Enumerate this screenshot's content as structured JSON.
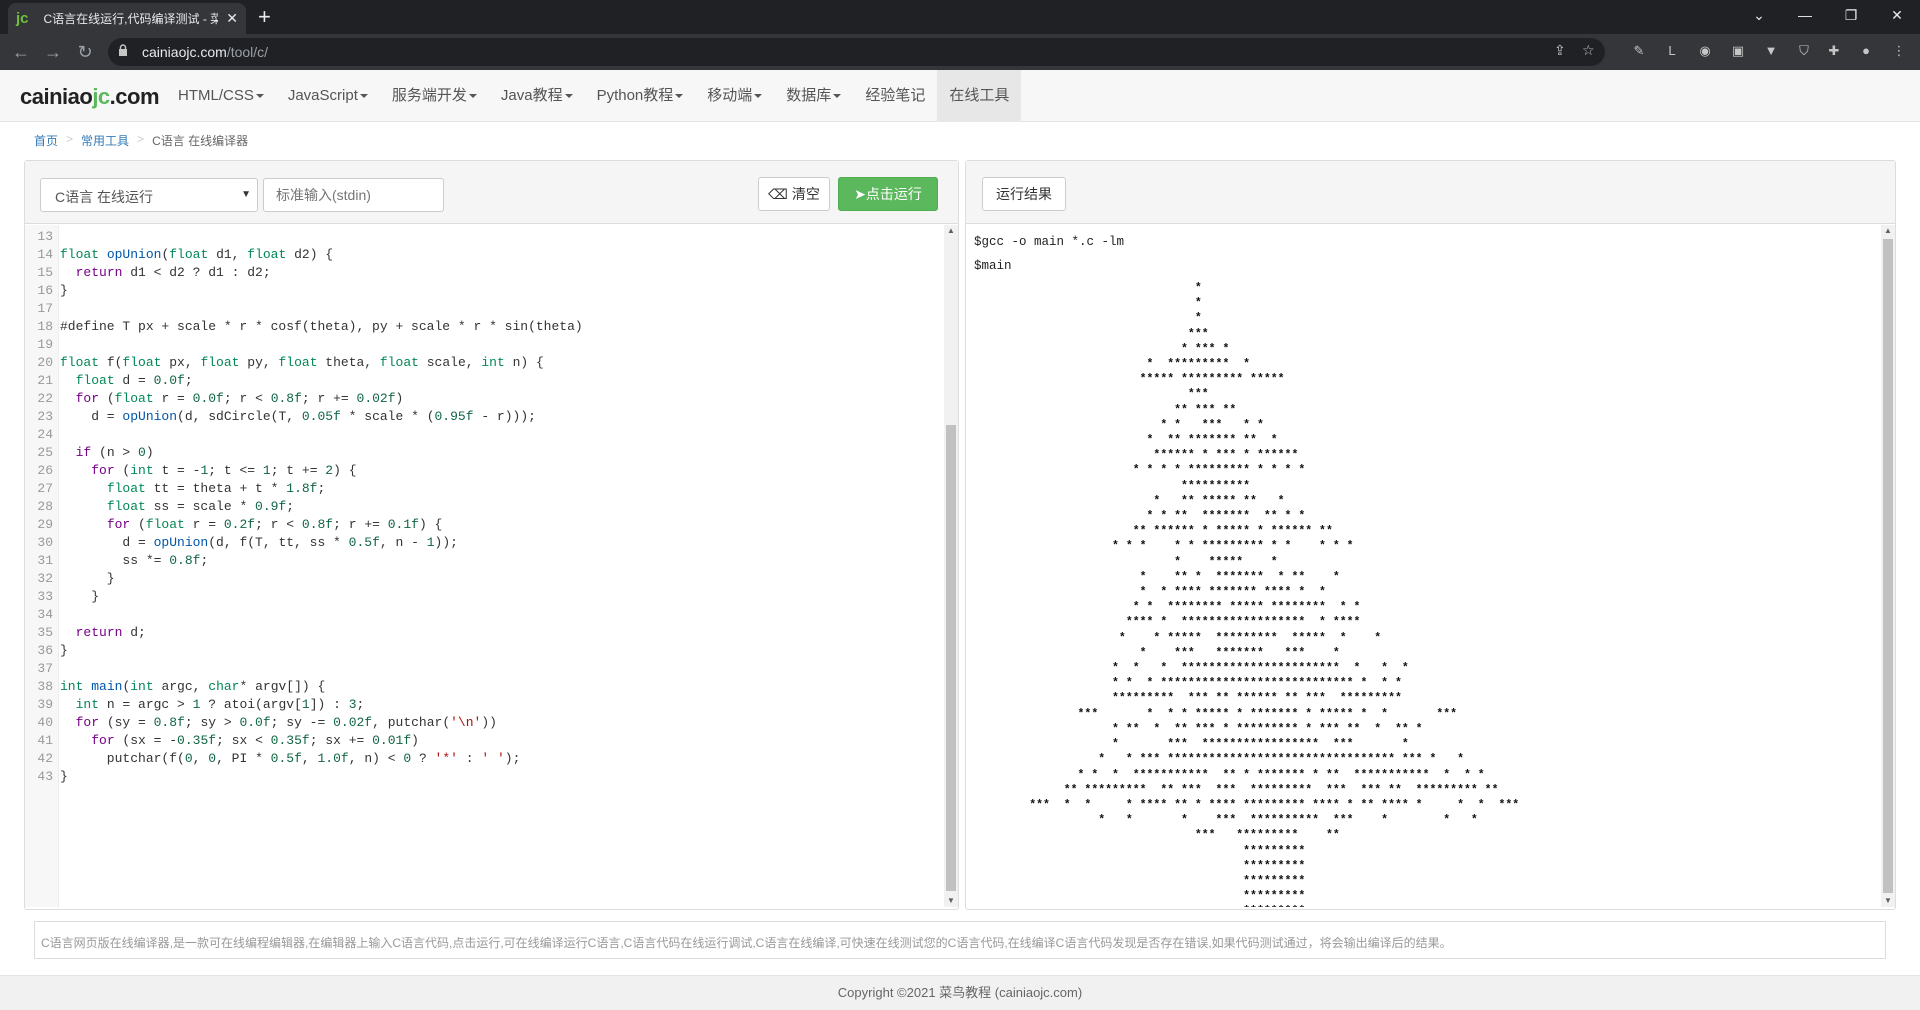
{
  "browser": {
    "tab_title": "C语言在线运行,代码编译测试 - 菜",
    "tab_favicon": "jc",
    "url_host": "cainiaojc.com",
    "url_path": "/tool/c/",
    "icons": [
      "back-icon",
      "forward-icon",
      "reload-icon",
      "lock-icon",
      "share-icon",
      "star-icon",
      "extension-icon",
      "profile-icon",
      "menu-icon"
    ]
  },
  "site": {
    "logo_main": "cainiao",
    "logo_accent": "jc",
    "logo_tail": ".com",
    "nav": [
      {
        "label": "HTML/CSS",
        "caret": true
      },
      {
        "label": "JavaScript",
        "caret": true
      },
      {
        "label": "服务端开发",
        "caret": true
      },
      {
        "label": "Java教程",
        "caret": true
      },
      {
        "label": "Python教程",
        "caret": true
      },
      {
        "label": "移动端",
        "caret": true
      },
      {
        "label": "数据库",
        "caret": true
      },
      {
        "label": "经验笔记",
        "caret": false
      },
      {
        "label": "在线工具",
        "caret": false
      }
    ]
  },
  "breadcrumb": {
    "home": "首页",
    "tools": "常用工具",
    "current": "C语言 在线编译器"
  },
  "editor": {
    "language_select": "C语言 在线运行",
    "stdin_placeholder": "标准输入(stdin)",
    "clear_label": "清空",
    "run_label": "点击运行"
  },
  "code_lines": [
    {
      "n": "13",
      "t": ""
    },
    {
      "n": "14",
      "t": "float opUnion(float d1, float d2) {"
    },
    {
      "n": "15",
      "t": "  return d1 < d2 ? d1 : d2;"
    },
    {
      "n": "16",
      "t": "}"
    },
    {
      "n": "17",
      "t": ""
    },
    {
      "n": "18",
      "t": "#define T px + scale * r * cosf(theta), py + scale * r * sin(theta)"
    },
    {
      "n": "19",
      "t": ""
    },
    {
      "n": "20",
      "t": "float f(float px, float py, float theta, float scale, int n) {"
    },
    {
      "n": "21",
      "t": "  float d = 0.0f;"
    },
    {
      "n": "22",
      "t": "  for (float r = 0.0f; r < 0.8f; r += 0.02f)"
    },
    {
      "n": "23",
      "t": "    d = opUnion(d, sdCircle(T, 0.05f * scale * (0.95f - r)));"
    },
    {
      "n": "24",
      "t": ""
    },
    {
      "n": "25",
      "t": "  if (n > 0)"
    },
    {
      "n": "26",
      "t": "    for (int t = -1; t <= 1; t += 2) {"
    },
    {
      "n": "27",
      "t": "      float tt = theta + t * 1.8f;"
    },
    {
      "n": "28",
      "t": "      float ss = scale * 0.9f;"
    },
    {
      "n": "29",
      "t": "      for (float r = 0.2f; r < 0.8f; r += 0.1f) {"
    },
    {
      "n": "30",
      "t": "        d = opUnion(d, f(T, tt, ss * 0.5f, n - 1));"
    },
    {
      "n": "31",
      "t": "        ss *= 0.8f;"
    },
    {
      "n": "32",
      "t": "      }"
    },
    {
      "n": "33",
      "t": "    }"
    },
    {
      "n": "34",
      "t": ""
    },
    {
      "n": "35",
      "t": "  return d;"
    },
    {
      "n": "36",
      "t": "}"
    },
    {
      "n": "37",
      "t": ""
    },
    {
      "n": "38",
      "t": "int main(int argc, char* argv[]) {"
    },
    {
      "n": "39",
      "t": "  int n = argc > 1 ? atoi(argv[1]) : 3;"
    },
    {
      "n": "40",
      "t": "  for (sy = 0.8f; sy > 0.0f; sy -= 0.02f, putchar('\\n'))"
    },
    {
      "n": "41",
      "t": "    for (sx = -0.35f; sx < 0.35f; sx += 0.01f)"
    },
    {
      "n": "42",
      "t": "      putchar(f(0, 0, PI * 0.5f, 1.0f, n) < 0 ? '*' : ' ');"
    },
    {
      "n": "43",
      "t": "}"
    }
  ],
  "result": {
    "label": "运行结果",
    "cmd1": "$gcc -o main *.c -lm",
    "cmd2": "$main",
    "output": "                                *\n                                *\n                                *\n                               ***\n                              * *** *\n                         *  *********  *\n                        ***** ********* *****\n                               ***\n                             ** *** **\n                           * *   ***   * *\n                         *  ** ******* **  *\n                          ****** * *** * ******\n                       * * * * ********* * * * *\n                              **********\n                          *   ** ***** **   *\n                         * * **  *******  ** * *\n                       ** ****** * ***** * ****** **\n                    * * *    * * ********* * *    * * *\n                             *    *****    *\n                        *    ** *  *******  * **    *\n                        *  * **** ******* **** *  *\n                       * *  ******** ***** ********  * *\n                      **** *  ******************  * ****\n                     *    * *****  *********  *****  *    *\n                        *    ***   *******   ***    *\n                    *  *   *  ***********************  *   *  *\n                    * *  * **************************** *  * *\n                    *********  *** ** ****** ** ***  *********\n               ***       *  * * ***** * ******* * ***** *  *       ***\n                    * **  *  ** *** * ********* * *** **  *  ** *\n                    *       ***  *****************  ***       *\n                  *   * *** ********************************* *** *   *\n               * *  *  ***********  ** * ******* * **  ***********  *  * *\n             ** *********  ** ***  ***  *********  ***  *** **  ********* **\n        ***  *  *     * **** ** * **** ********* **** * ** **** *     *  *  ***\n                  *   *       *    ***  **********  ***    *        *   *\n                                ***   *********    **\n                                       *********\n                                       *********\n                                       *********\n                                       *********\n                                       *********"
  },
  "description": "C语言网页版在线编译器,是一款可在线编程编辑器,在编辑器上输入C语言代码,点击运行,可在线编译运行C语言,C语言代码在线运行调试,C语言在线编译,可快速在线测试您的C语言代码,在线编译C语言代码发现是否存在错误,如果代码测试通过，将会输出编译后的结果。",
  "footer": "Copyright ©2021 菜鸟教程 (cainiaojc.com)"
}
